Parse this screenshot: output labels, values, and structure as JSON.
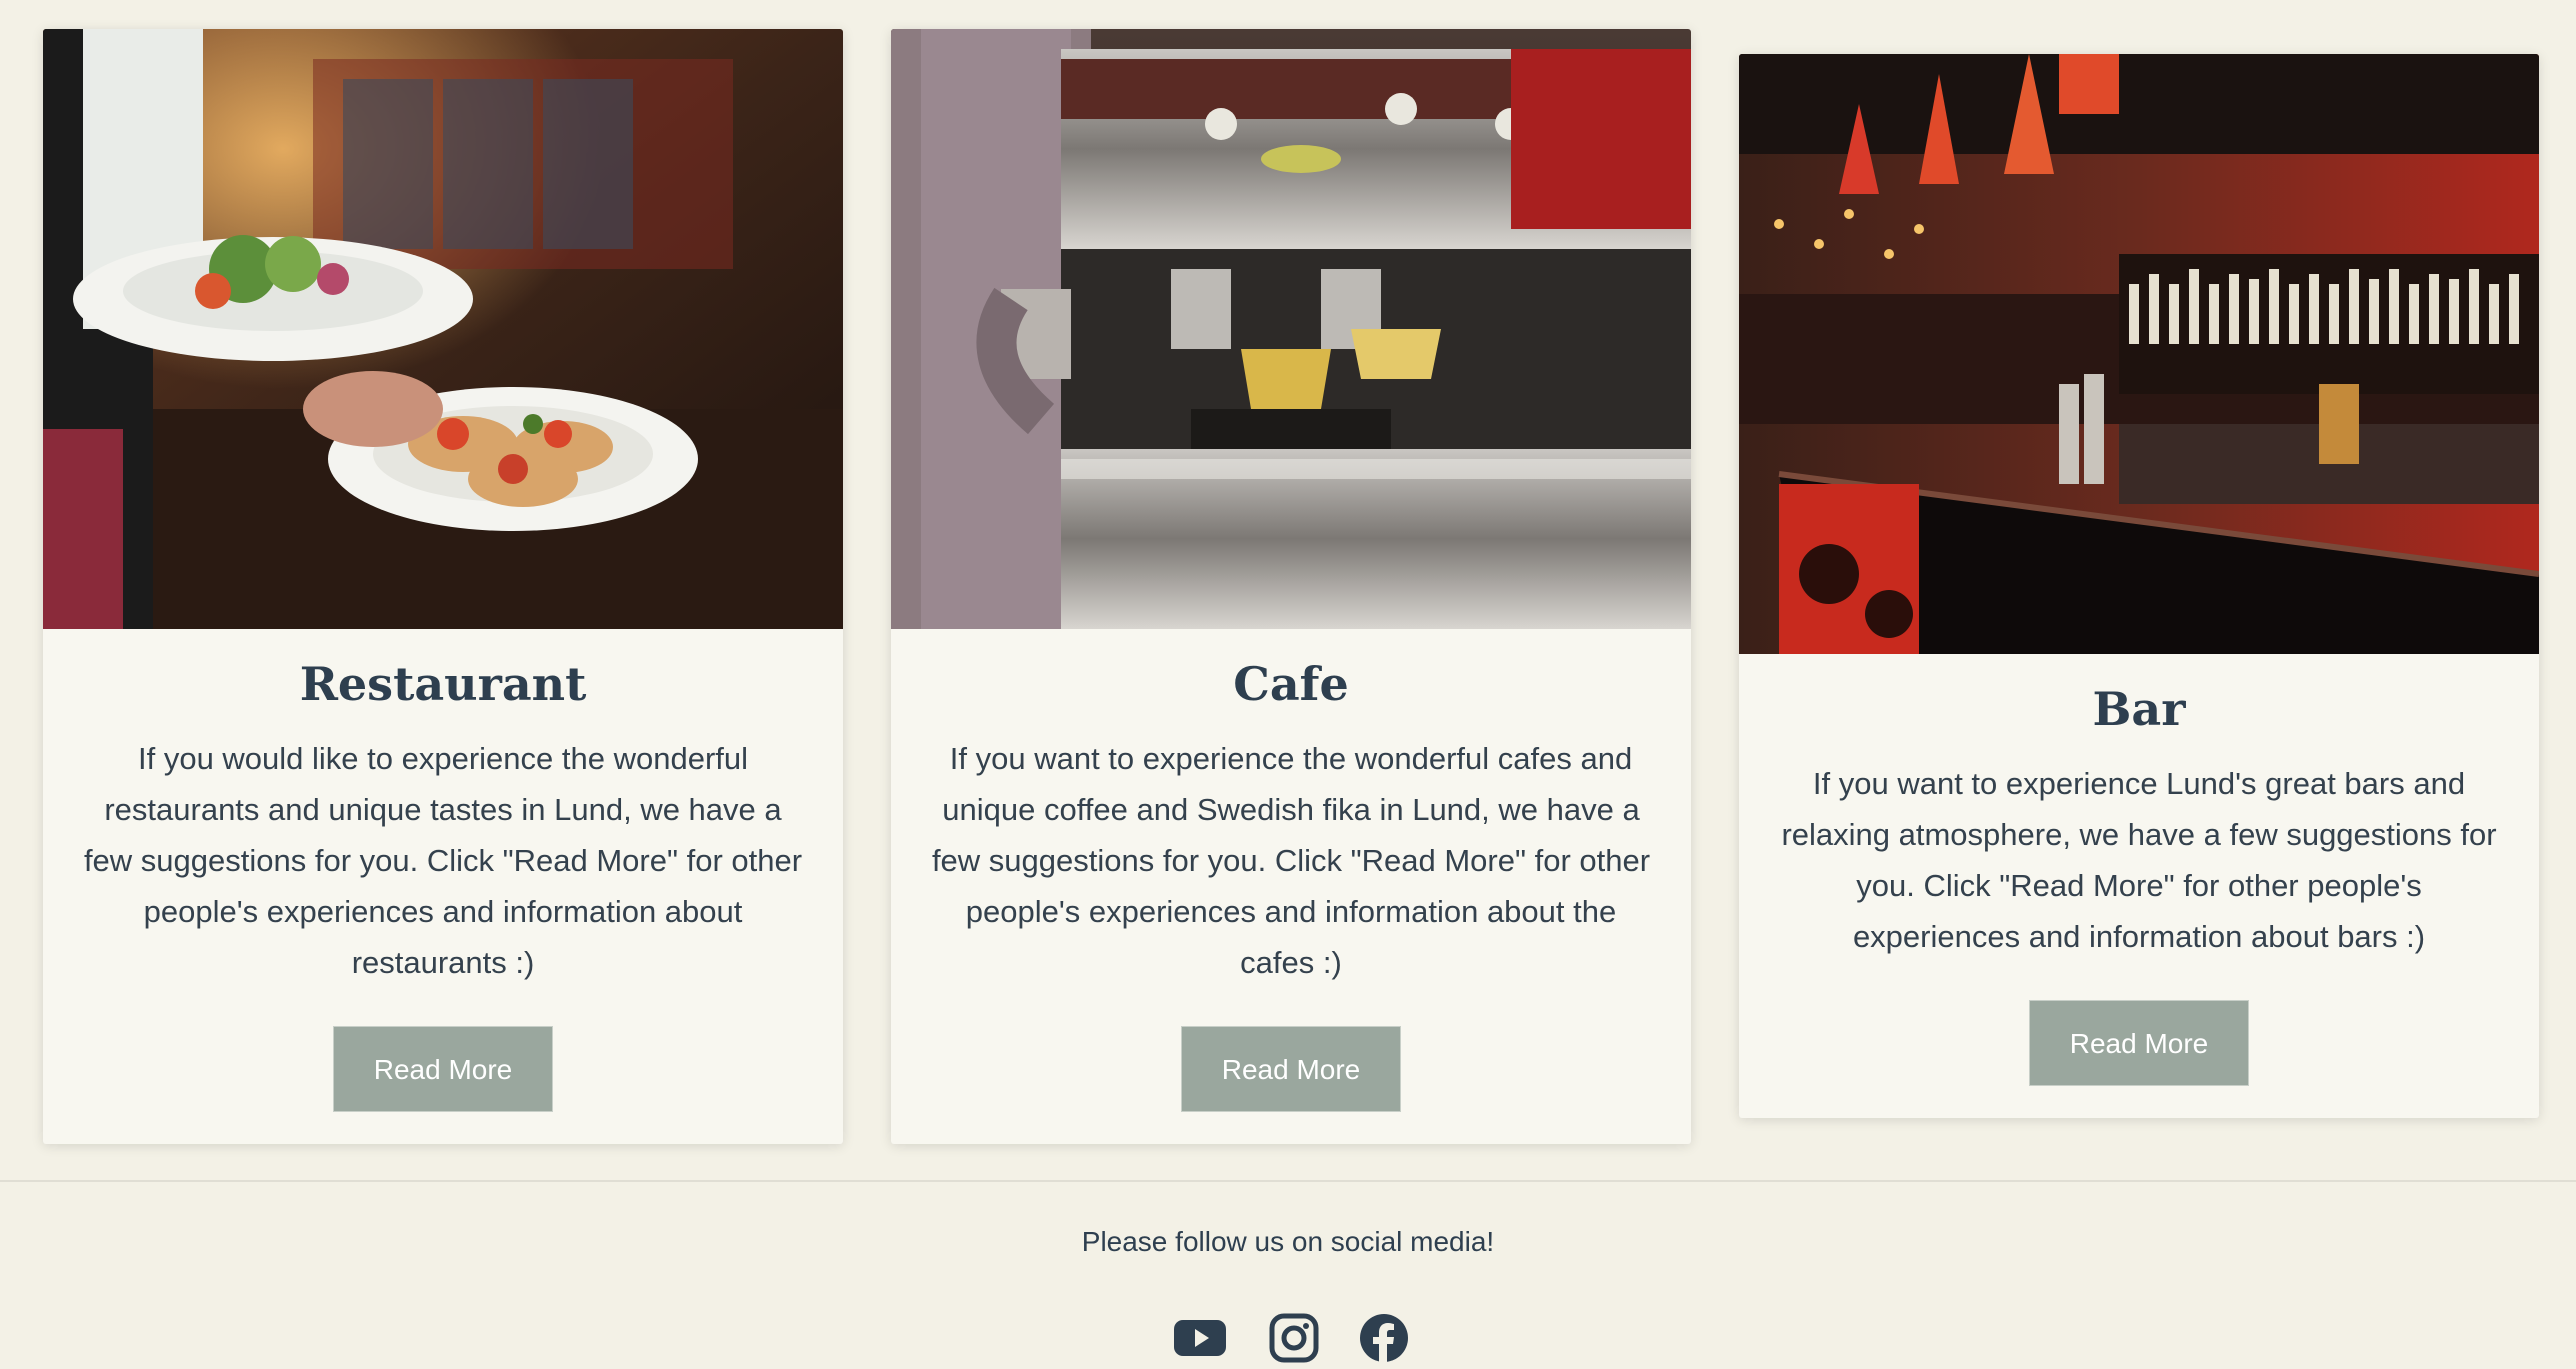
{
  "cards": [
    {
      "title": "Restaurant",
      "text": "If you would like to experience the wonderful restaurants and unique tastes in Lund, we have a few suggestions for you. Click \"Read More\" for other people's experiences and information about restaurants :)",
      "button": "Read More",
      "image_icon": "restaurant-photo"
    },
    {
      "title": "Cafe",
      "text": "If you want to experience the wonderful cafes and unique coffee and Swedish fika in Lund, we have a few suggestions for you. Click \"Read More\" for other people's experiences and information about the cafes :)",
      "button": "Read More",
      "image_icon": "cafe-photo"
    },
    {
      "title": "Bar",
      "text": "If you want to experience Lund's great bars and relaxing atmosphere, we have a few suggestions for you. Click \"Read More\" for other people's experiences and information about bars :)",
      "button": "Read More",
      "image_icon": "bar-photo"
    }
  ],
  "footer": {
    "follow_text": "Please follow us on social media!",
    "social_icons": [
      "youtube-icon",
      "instagram-icon",
      "facebook-icon"
    ]
  },
  "colors": {
    "page_background": "#f3f1e6",
    "card_background": "#f8f7f0",
    "button_background": "#9aa79e",
    "heading_text": "#2e3f4f"
  }
}
